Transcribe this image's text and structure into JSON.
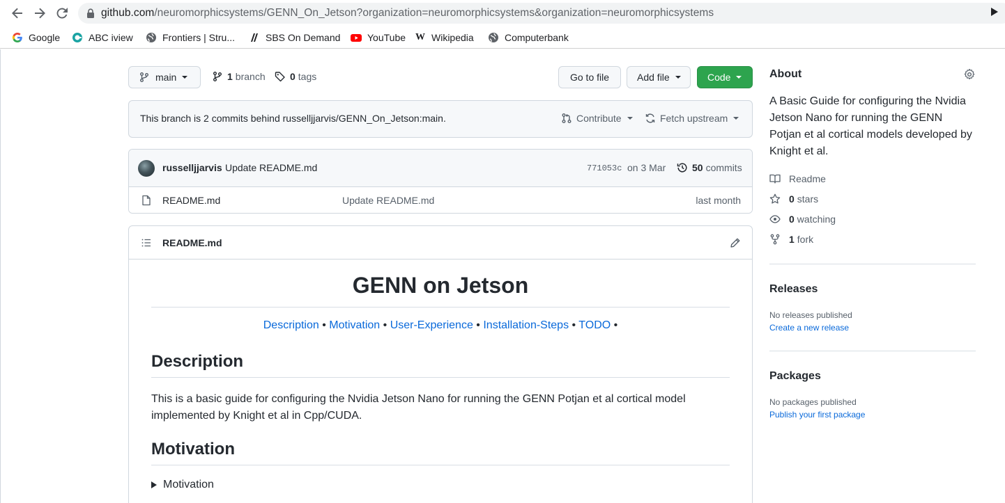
{
  "browser": {
    "url_host": "github.com",
    "url_path": "/neuromorphicsystems/GENN_On_Jetson?organization=neuromorphicsystems&organization=neuromorphicsystems",
    "bookmarks": [
      {
        "label": "Google",
        "icon": "google-icon"
      },
      {
        "label": "ABC iview",
        "icon": "abc-iview-icon"
      },
      {
        "label": "Frontiers | Stru...",
        "icon": "globe-icon"
      },
      {
        "label": "SBS On Demand",
        "icon": "sbs-icon"
      },
      {
        "label": "YouTube",
        "icon": "youtube-icon"
      },
      {
        "label": "Wikipedia",
        "icon": "wikipedia-icon"
      },
      {
        "label": "Computerbank",
        "icon": "globe-icon"
      }
    ]
  },
  "repo": {
    "branch_button": "main",
    "branches_count": "1",
    "branches_label": "branch",
    "tags_count": "0",
    "tags_label": "tags",
    "go_to_file": "Go to file",
    "add_file": "Add file",
    "code": "Code",
    "behind_text": "This branch is 2 commits behind russelljjarvis/GENN_On_Jetson:main.",
    "contribute": "Contribute",
    "fetch_upstream": "Fetch upstream"
  },
  "latest_commit": {
    "author": "russelljjarvis",
    "message": "Update README.md",
    "sha": "771053c",
    "date": "on 3 Mar",
    "count": "50",
    "count_label": "commits"
  },
  "files": [
    {
      "name": "README.md",
      "commit": "Update README.md",
      "age": "last month"
    }
  ],
  "readme": {
    "filename": "README.md",
    "title": "GENN on Jetson",
    "toc": [
      "Description",
      "Motivation",
      "User-Experience",
      "Installation-Steps",
      "TODO"
    ],
    "toc_sep": " • ",
    "toc_tail": " •",
    "h_description": "Description",
    "description": "This is a basic guide for configuring the Nvidia Jetson Nano for running the GENN Potjan et al cortical model implemented by Knight et al in Cpp/CUDA.",
    "h_motivation": "Motivation",
    "summary": "Motivation"
  },
  "sidebar": {
    "about_title": "About",
    "about_desc": "A Basic Guide for configuring the Nvidia Jetson Nano for running the GENN Potjan et al cortical models developed by Knight et al.",
    "readme": "Readme",
    "stars_count": "0",
    "stars_label": "stars",
    "watching_count": "0",
    "watching_label": "watching",
    "fork_count": "1",
    "fork_label": "fork",
    "releases_title": "Releases",
    "releases_none": "No releases published",
    "releases_link": "Create a new release",
    "packages_title": "Packages",
    "packages_none": "No packages published",
    "packages_link": "Publish your first package"
  },
  "colors": {
    "accent_link": "#0969da",
    "code_button": "#2da44e",
    "border": "#d0d7de"
  }
}
